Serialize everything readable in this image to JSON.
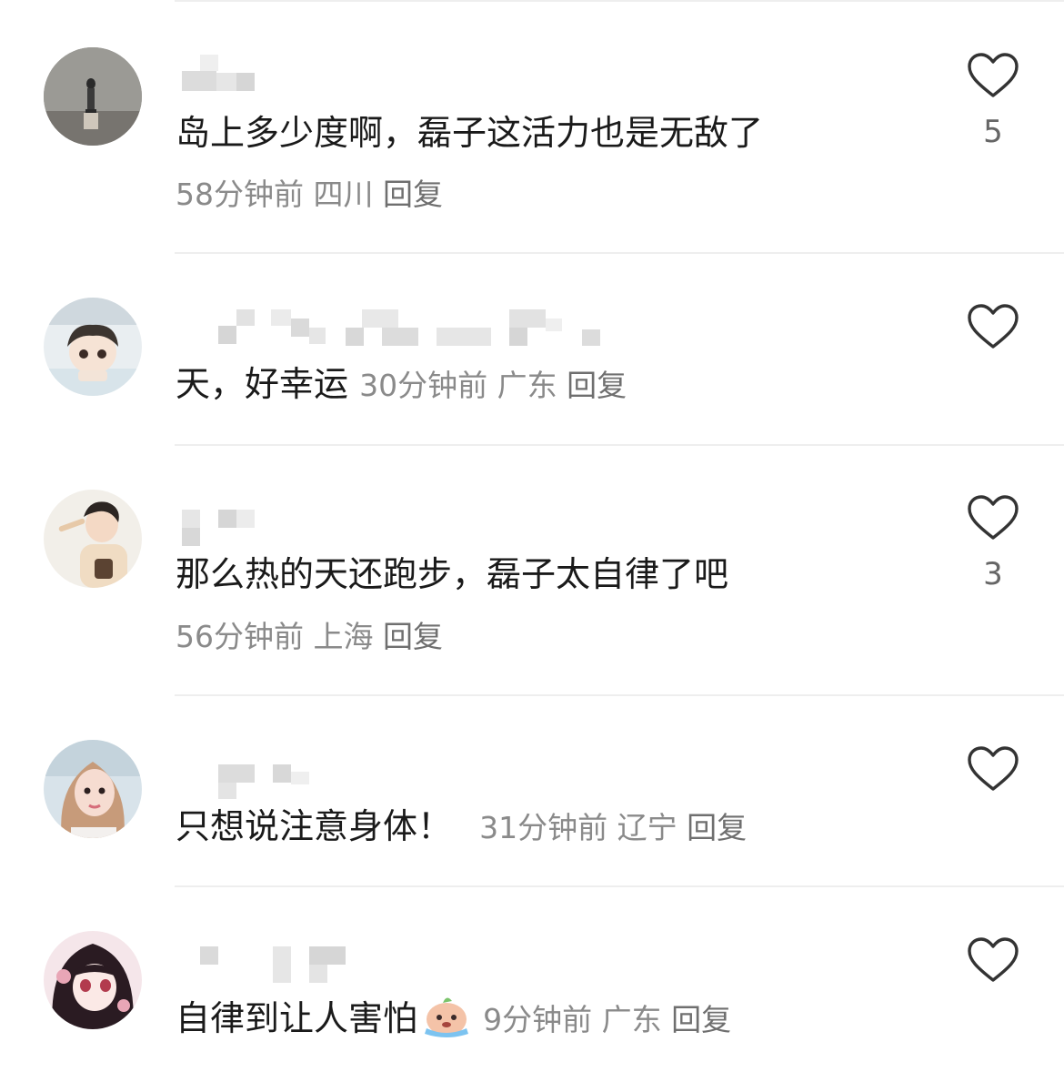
{
  "comments": [
    {
      "text": "岛上多少度啊，磊子这活力也是无敌了",
      "time": "58分钟前",
      "location": "四川",
      "reply_label": "回复",
      "likes": "5"
    },
    {
      "text": "天，好幸运",
      "time": "30分钟前",
      "location": "广东",
      "reply_label": "回复",
      "likes": ""
    },
    {
      "text": "那么热的天还跑步，磊子太自律了吧",
      "time": "56分钟前",
      "location": "上海",
      "reply_label": "回复",
      "likes": "3"
    },
    {
      "text": "只想说注意身体！",
      "time": "31分钟前",
      "location": "辽宁",
      "reply_label": "回复",
      "likes": ""
    },
    {
      "text": "自律到让人害怕",
      "time": "9分钟前",
      "location": "广东",
      "reply_label": "回复",
      "likes": ""
    }
  ],
  "icons": {
    "like": "heart-outline-icon",
    "emoji": "crying-emoji-icon"
  },
  "colors": {
    "text": "#1a1a1a",
    "meta": "#8a8a8a",
    "heart_stroke": "#333333",
    "divider": "#eeeeee"
  }
}
